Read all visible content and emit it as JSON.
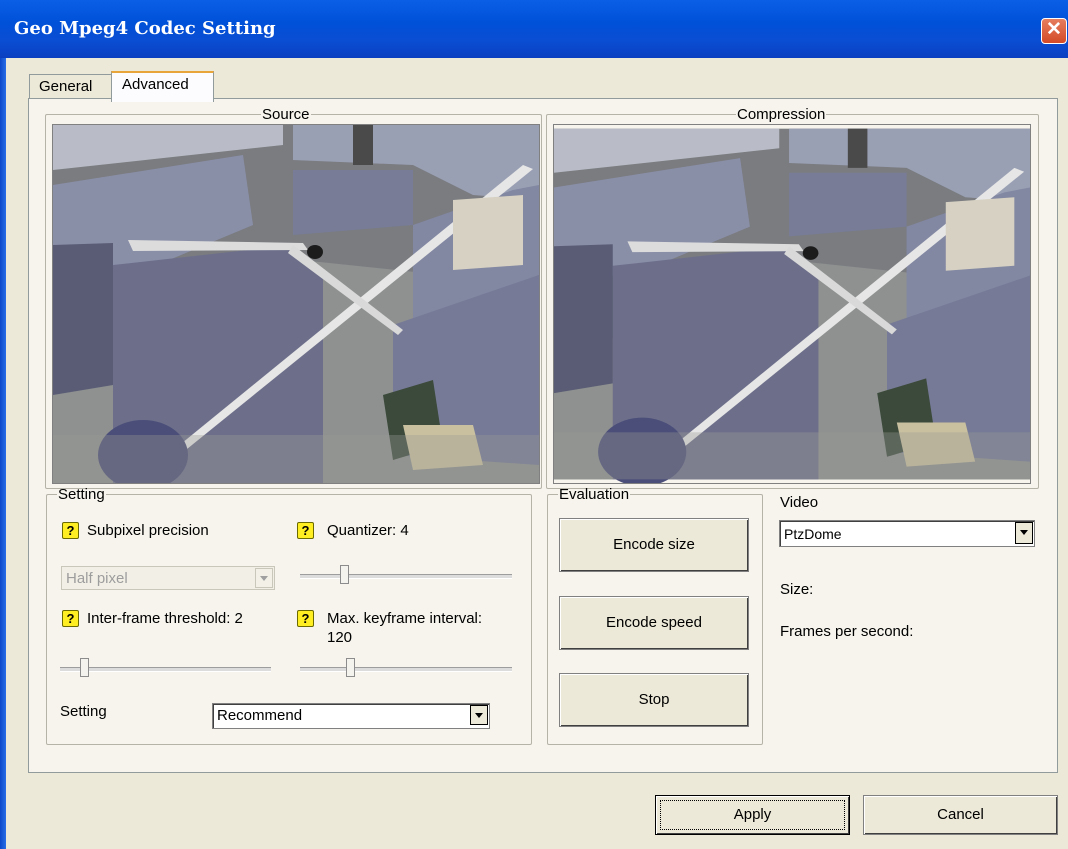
{
  "window": {
    "title": "Geo Mpeg4 Codec Setting"
  },
  "tabs": [
    {
      "label": "General"
    },
    {
      "label": "Advanced"
    }
  ],
  "source": {
    "label": "Source"
  },
  "compression": {
    "label": "Compression"
  },
  "setting_group": {
    "label": "Setting",
    "subpixel": {
      "label": "Subpixel precision",
      "value": "Half pixel"
    },
    "quantizer": {
      "label": "Quantizer: 4",
      "value": 4
    },
    "interframe": {
      "label": "Inter-frame threshold: 2",
      "value": 2
    },
    "keyframe": {
      "label": "Max. keyframe interval:",
      "value_text": "120"
    },
    "preset": {
      "label": "Setting",
      "value": "Recommend"
    }
  },
  "evaluation": {
    "label": "Evaluation",
    "encode_size": "Encode size",
    "encode_speed": "Encode speed",
    "stop": "Stop"
  },
  "video": {
    "label": "Video",
    "value": "PtzDome",
    "size_label": "Size:",
    "fps_label": "Frames per second:"
  },
  "footer": {
    "apply": "Apply",
    "cancel": "Cancel"
  },
  "icons": {
    "help": "help-icon",
    "close": "close-icon",
    "dropdown": "chevron-down-icon"
  }
}
